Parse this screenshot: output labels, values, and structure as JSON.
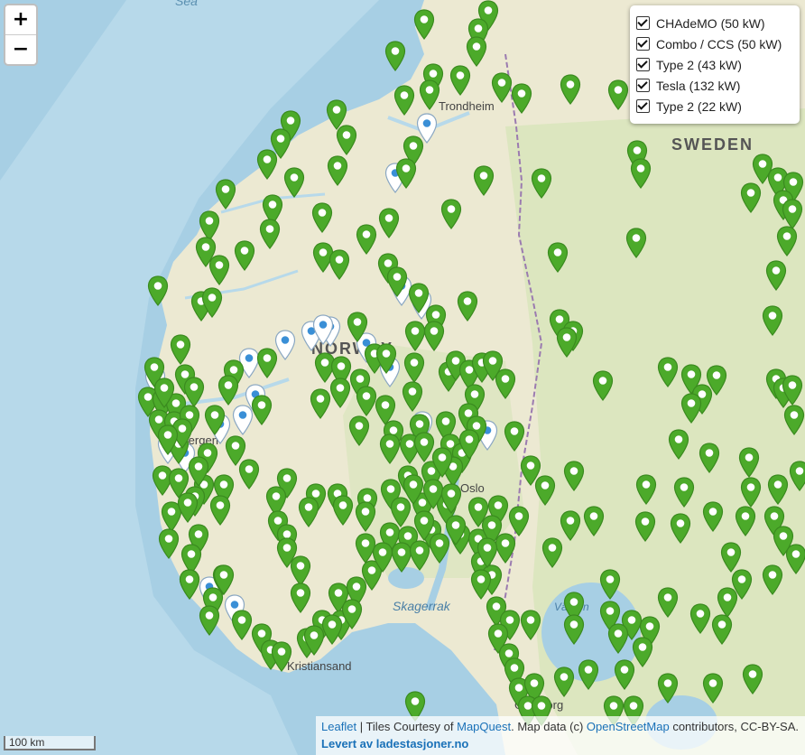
{
  "map": {
    "place_labels": [
      "Sea",
      "Trondheim",
      "SWEDEN",
      "NORWAY",
      "Oslo",
      "Bergen",
      "Skagerrak",
      "Vänern",
      "Kristiansand",
      "Göteborg"
    ]
  },
  "zoom": {
    "in_label": "+",
    "out_label": "−"
  },
  "legend": {
    "items": [
      {
        "label": "CHAdeMO (50 kW)",
        "checked": true
      },
      {
        "label": "Combo / CCS (50 kW)",
        "checked": true
      },
      {
        "label": "Type 2 (43 kW)",
        "checked": true
      },
      {
        "label": "Tesla (132 kW)",
        "checked": true
      },
      {
        "label": "Type 2 (22 kW)",
        "checked": true
      }
    ]
  },
  "scale": {
    "label": "100 km"
  },
  "attribution": {
    "leaflet": "Leaflet",
    "sep": " | Tiles Courtesy of ",
    "mapquest": "MapQuest",
    "map_data": ". Map data (c) ",
    "osm": "OpenStreetMap",
    "rest": " contributors, CC-BY-SA.",
    "credit": "Levert av ladestasjoner.no"
  },
  "colors": {
    "sea": "#a7cfe4",
    "land": "#ece9d2",
    "forest": "#d6e4b6",
    "border": "#9b7bb0",
    "marker_green": "#4caa2a",
    "marker_white": "#ffffff",
    "marker_blue_dot": "#3a8fd6",
    "link": "#1a71b8"
  },
  "icons": {
    "charging_marker": "map-pin-icon",
    "selected_marker": "map-pin-highlight-icon"
  }
}
